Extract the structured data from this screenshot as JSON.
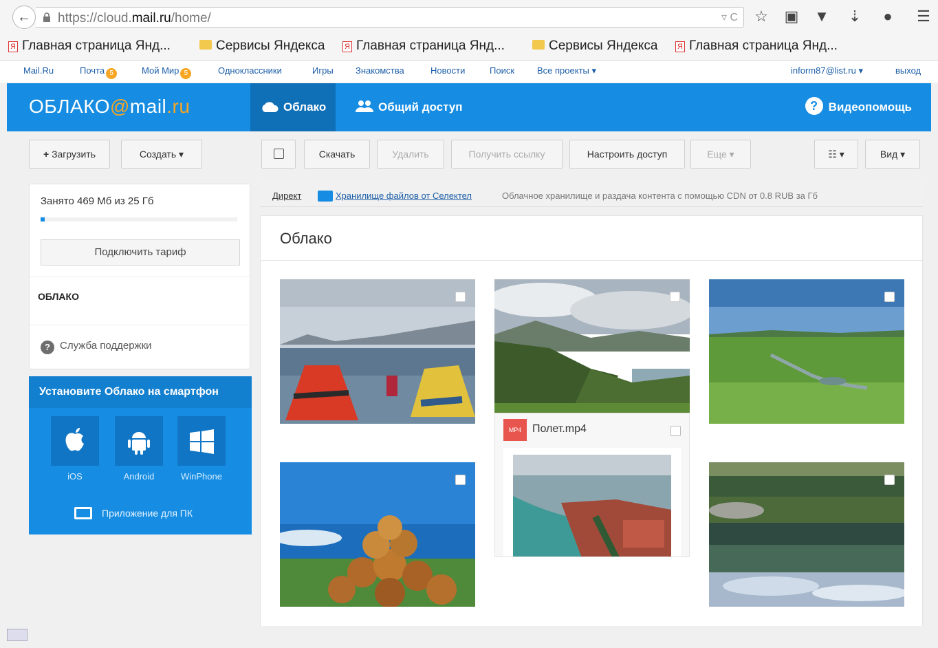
{
  "browser": {
    "url_prefix": "https://cloud.",
    "url_domain": "mail.ru",
    "url_path": "/home/",
    "bookmarks": [
      {
        "label": "Главная страница Янд...",
        "type": "yandex"
      },
      {
        "label": "Сервисы Яндекса",
        "type": "folder"
      },
      {
        "label": "Главная страница Янд...",
        "type": "yandex"
      },
      {
        "label": "Сервисы Яндекса",
        "type": "folder"
      },
      {
        "label": "Главная страница Янд...",
        "type": "yandex"
      }
    ]
  },
  "portal": {
    "links": [
      "Mail.Ru",
      "Почта",
      "Мой Мир",
      "Одноклассники",
      "Игры",
      "Знакомства",
      "Новости",
      "Поиск",
      "Все проекты"
    ],
    "badge_mail": "5",
    "badge_mir": "5",
    "user": "inform87@list.ru",
    "logout": "выход"
  },
  "header": {
    "logo_prefix": "ОБЛАКО",
    "logo_at": "@",
    "logo_mail": "mail",
    "logo_dot": ".",
    "logo_ru": "ru",
    "tab_cloud": "Облако",
    "tab_shared": "Общий доступ",
    "help": "Видеопомощь"
  },
  "toolbar": {
    "upload": "Загрузить",
    "create": "Создать",
    "download": "Скачать",
    "delete": "Удалить",
    "get_link": "Получить ссылку",
    "share": "Настроить доступ",
    "more": "Еще",
    "view": "Вид"
  },
  "sidebar": {
    "storage": "Занято 469 Мб из 25 Гб",
    "storage_fraction": 0.02,
    "tarif": "Подключить тариф",
    "section": "ОБЛАКО",
    "support": "Служба поддержки",
    "app_title": "Установите Облако на смартфон",
    "ios": "iOS",
    "android": "Android",
    "winphone": "WinPhone",
    "pc_app": "Приложение для ПК"
  },
  "ad": {
    "tag": "Директ",
    "link": "Хранилище файлов от Селектел",
    "description": "Облачное хранилище и раздача контента с помощью CDN от 0.8 RUB за Гб"
  },
  "main": {
    "title": "Облако",
    "video_badge": "MP4",
    "video_name": "Полет.mp4"
  },
  "colors": {
    "accent": "#168de2",
    "accent_dark": "#0f6fb7",
    "orange": "#f6a623"
  }
}
